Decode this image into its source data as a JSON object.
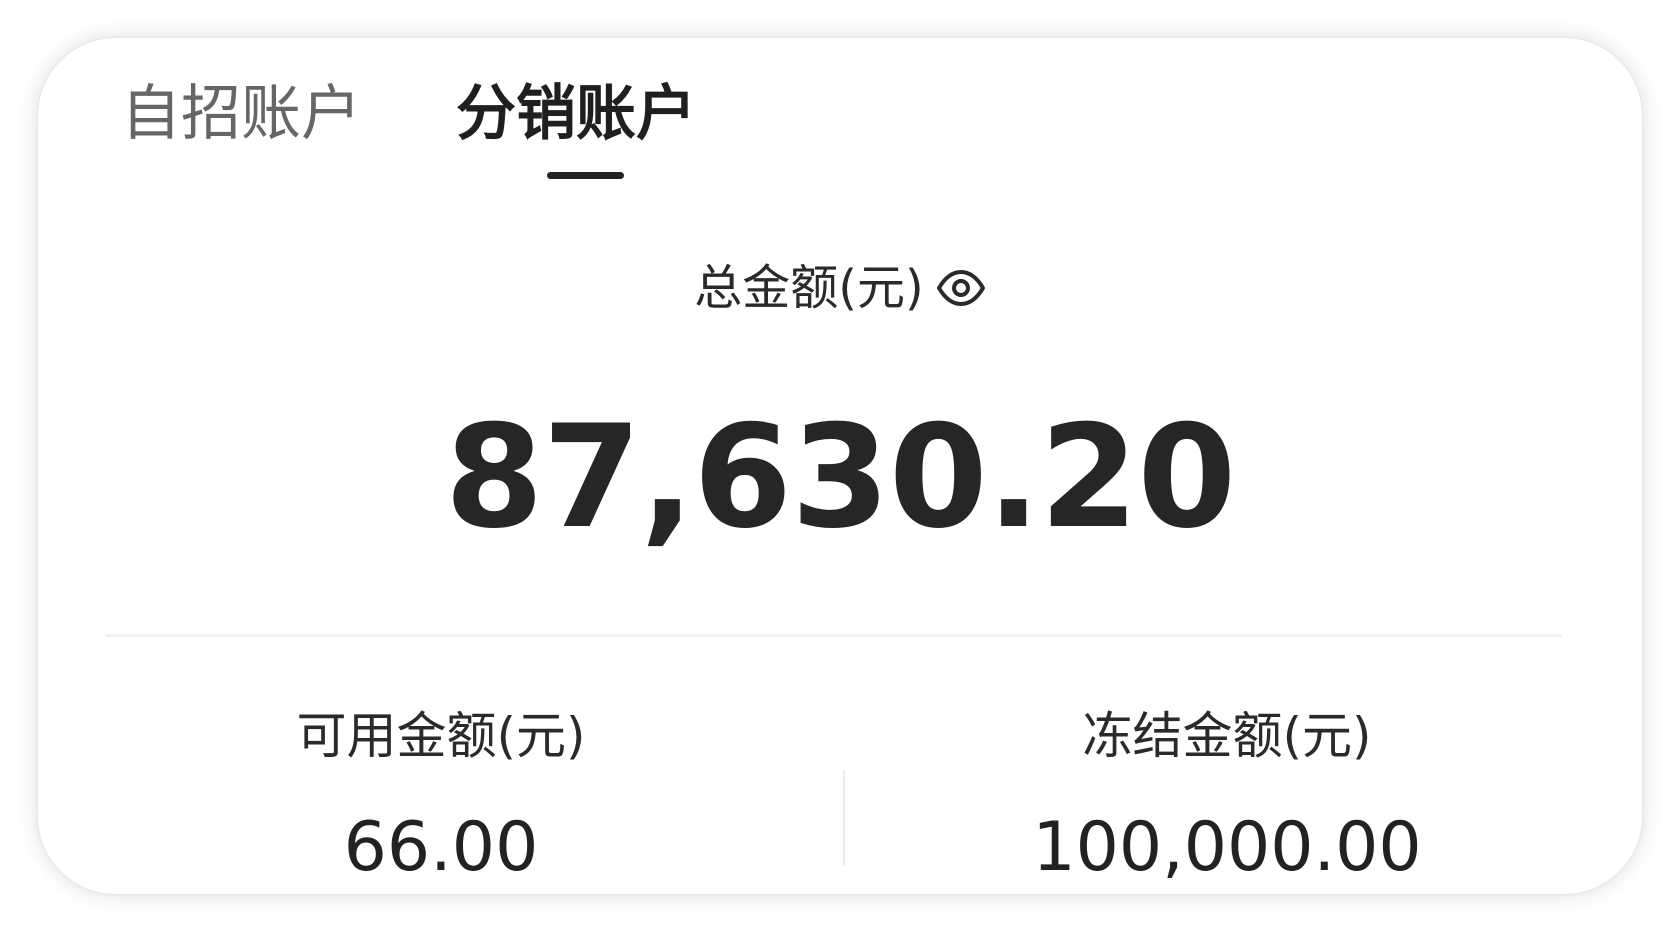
{
  "tabs": [
    {
      "label": "自招账户",
      "active": false
    },
    {
      "label": "分销账户",
      "active": true
    }
  ],
  "summary": {
    "total_label": "总金额(元)",
    "total_value": "87,630.20",
    "visibility_icon": "eye-icon"
  },
  "balances": {
    "available": {
      "label": "可用金额(元)",
      "value": "66.00"
    },
    "frozen": {
      "label": "冻结金额(元)",
      "value": "100,000.00"
    }
  },
  "colors": {
    "card_background": "#ffffff",
    "active_tab_text": "#1f1f1f",
    "inactive_tab_text": "#666666",
    "amount_text": "#262626",
    "divider": "#f0f0f0"
  }
}
